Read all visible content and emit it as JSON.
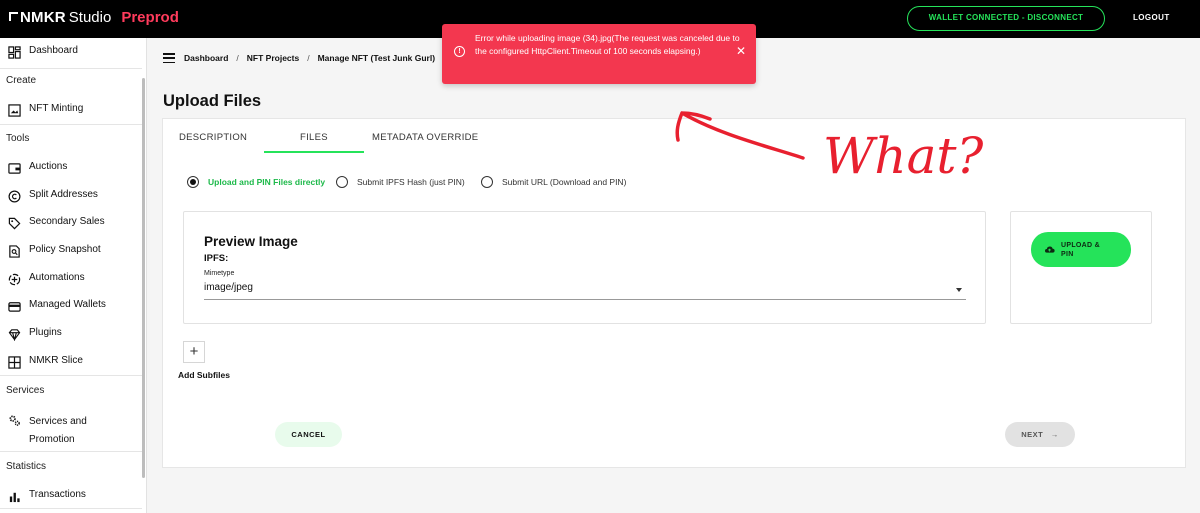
{
  "topbar": {
    "brand_name": "NMKR",
    "brand_product": "Studio",
    "environment": "Preprod",
    "wallet_button": "WALLET CONNECTED - DISCONNECT",
    "logout": "LOGOUT",
    "accent_color": "#25e35a",
    "env_color": "#ff3b5c"
  },
  "sidebar": {
    "dashboard": "Dashboard",
    "section_create": "Create",
    "nft_minting": "NFT Minting",
    "section_tools": "Tools",
    "tools": [
      {
        "label": "Auctions",
        "icon": "wallet-icon"
      },
      {
        "label": "Split Addresses",
        "icon": "copyright-icon"
      },
      {
        "label": "Secondary Sales",
        "icon": "tag-icon"
      },
      {
        "label": "Policy Snapshot",
        "icon": "search-document-icon"
      },
      {
        "label": "Automations",
        "icon": "automation-icon"
      },
      {
        "label": "Managed Wallets",
        "icon": "card-icon"
      },
      {
        "label": "Plugins",
        "icon": "diamond-icon"
      },
      {
        "label": "NMKR Slice",
        "icon": "grid-icon"
      }
    ],
    "section_services": "Services",
    "services_line1": "Services and",
    "services_line2": "Promotion",
    "section_statistics": "Statistics",
    "transactions": "Transactions"
  },
  "breadcrumb": {
    "items": [
      "Dashboard",
      "NFT Projects",
      "Manage NFT (Test Junk Gurl)"
    ],
    "separator": "/"
  },
  "toast": {
    "message": "Error while uploading image (34).jpg(The request was canceled due to the configured HttpClient.Timeout of 100 seconds elapsing.)",
    "icon_glyph": "!",
    "close_glyph": "✕",
    "color": "#f3374f"
  },
  "annotation": {
    "text": "What?"
  },
  "page": {
    "title": "Upload Files"
  },
  "tabs": {
    "description": "DESCRIPTION",
    "files": "FILES",
    "metadata": "METADATA OVERRIDE",
    "active": "FILES"
  },
  "upload_mode": {
    "options": [
      "Upload and PIN Files directly",
      "Submit IPFS Hash (just PIN)",
      "Submit URL (Download and PIN)"
    ],
    "selected": "Upload and PIN Files directly"
  },
  "preview": {
    "title": "Preview Image",
    "ipfs_label": "IPFS:",
    "mimetype_label": "Mimetype",
    "mimetype_value": "image/jpeg"
  },
  "upload_button": {
    "line1": "UPLOAD &",
    "line2": "PIN"
  },
  "subfiles": {
    "plus": "+",
    "label": "Add Subfiles"
  },
  "actions": {
    "cancel": "CANCEL",
    "next": "NEXT",
    "next_arrow": "→"
  }
}
